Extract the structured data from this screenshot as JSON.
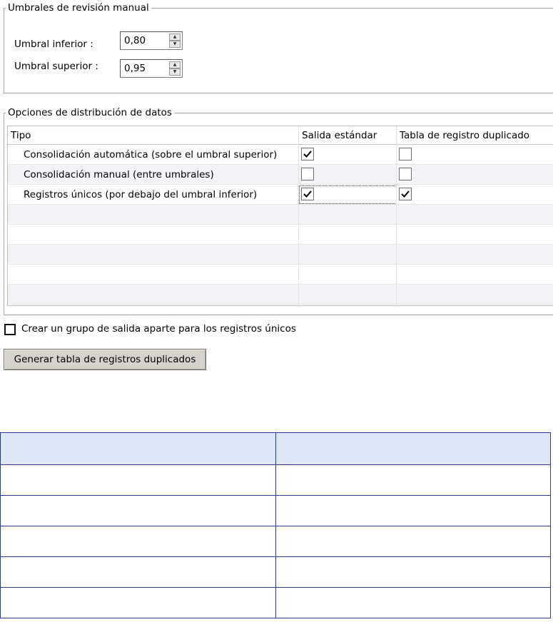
{
  "thresholds": {
    "legend": "Umbrales de revisión manual",
    "lower": {
      "label": "Umbral inferior :",
      "value": "0,80"
    },
    "upper": {
      "label": "Umbral superior :",
      "value": "0,95"
    }
  },
  "distribution": {
    "legend": "Opciones de distribución de datos",
    "columns": [
      "Tipo",
      "Salida estándar",
      "Tabla de registro duplicado"
    ],
    "rows": [
      {
        "type": "Consolidación automática (sobre el umbral superior)",
        "standard_output": true,
        "duplicate_table": false
      },
      {
        "type": "Consolidación manual (entre umbrales)",
        "standard_output": false,
        "duplicate_table": false
      },
      {
        "type": "Registros únicos (por debajo del umbral inferior)",
        "standard_output": true,
        "duplicate_table": true
      }
    ]
  },
  "separate_group": {
    "label": "Crear un grupo de salida aparte para los registros únicos",
    "checked": false
  },
  "generate_button": {
    "label": "Generar tabla de registros duplicados"
  },
  "colors": {
    "table_border": "#2b3a8f",
    "table_header": "#dde6f5",
    "row_alt": "#f2f4f8"
  }
}
